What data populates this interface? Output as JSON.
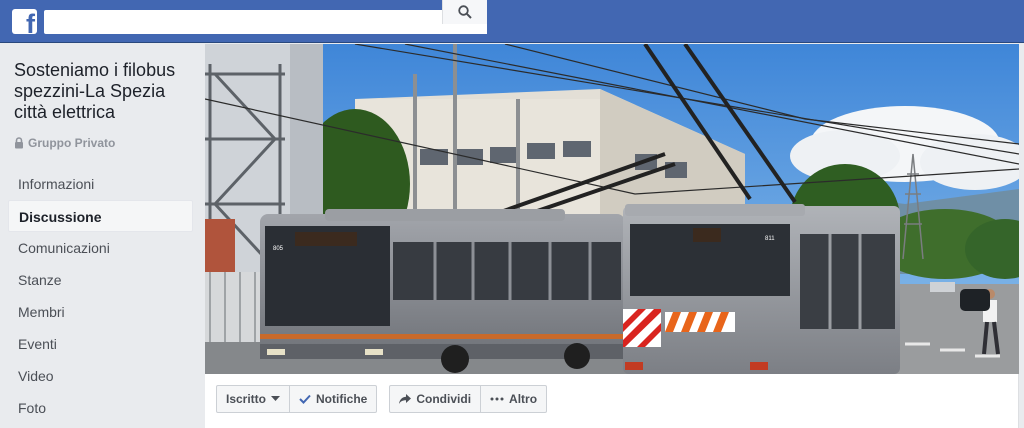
{
  "header": {
    "logo_letter": "f",
    "search": {
      "value": "",
      "placeholder": ""
    }
  },
  "group": {
    "title": "Sosteniamo i filobus spezzini-La Spezia città elettrica",
    "privacy": "Gruppo Privato"
  },
  "sidebar": {
    "items": [
      {
        "label": "Informazioni",
        "active": false
      },
      {
        "label": "Discussione",
        "active": true
      },
      {
        "label": "Comunicazioni",
        "active": false
      },
      {
        "label": "Stanze",
        "active": false
      },
      {
        "label": "Membri",
        "active": false
      },
      {
        "label": "Eventi",
        "active": false
      },
      {
        "label": "Video",
        "active": false
      },
      {
        "label": "Foto",
        "active": false
      }
    ]
  },
  "cover": {
    "bus_left_number": "805",
    "bus_right_number": "811"
  },
  "actions": {
    "iscritto": "Iscritto",
    "notifiche": "Notifiche",
    "condividi": "Condividi",
    "altro": "Altro"
  },
  "colors": {
    "brand": "#4267b2",
    "sky": "#4e8fd6",
    "bus_grey": "#8d9096"
  }
}
